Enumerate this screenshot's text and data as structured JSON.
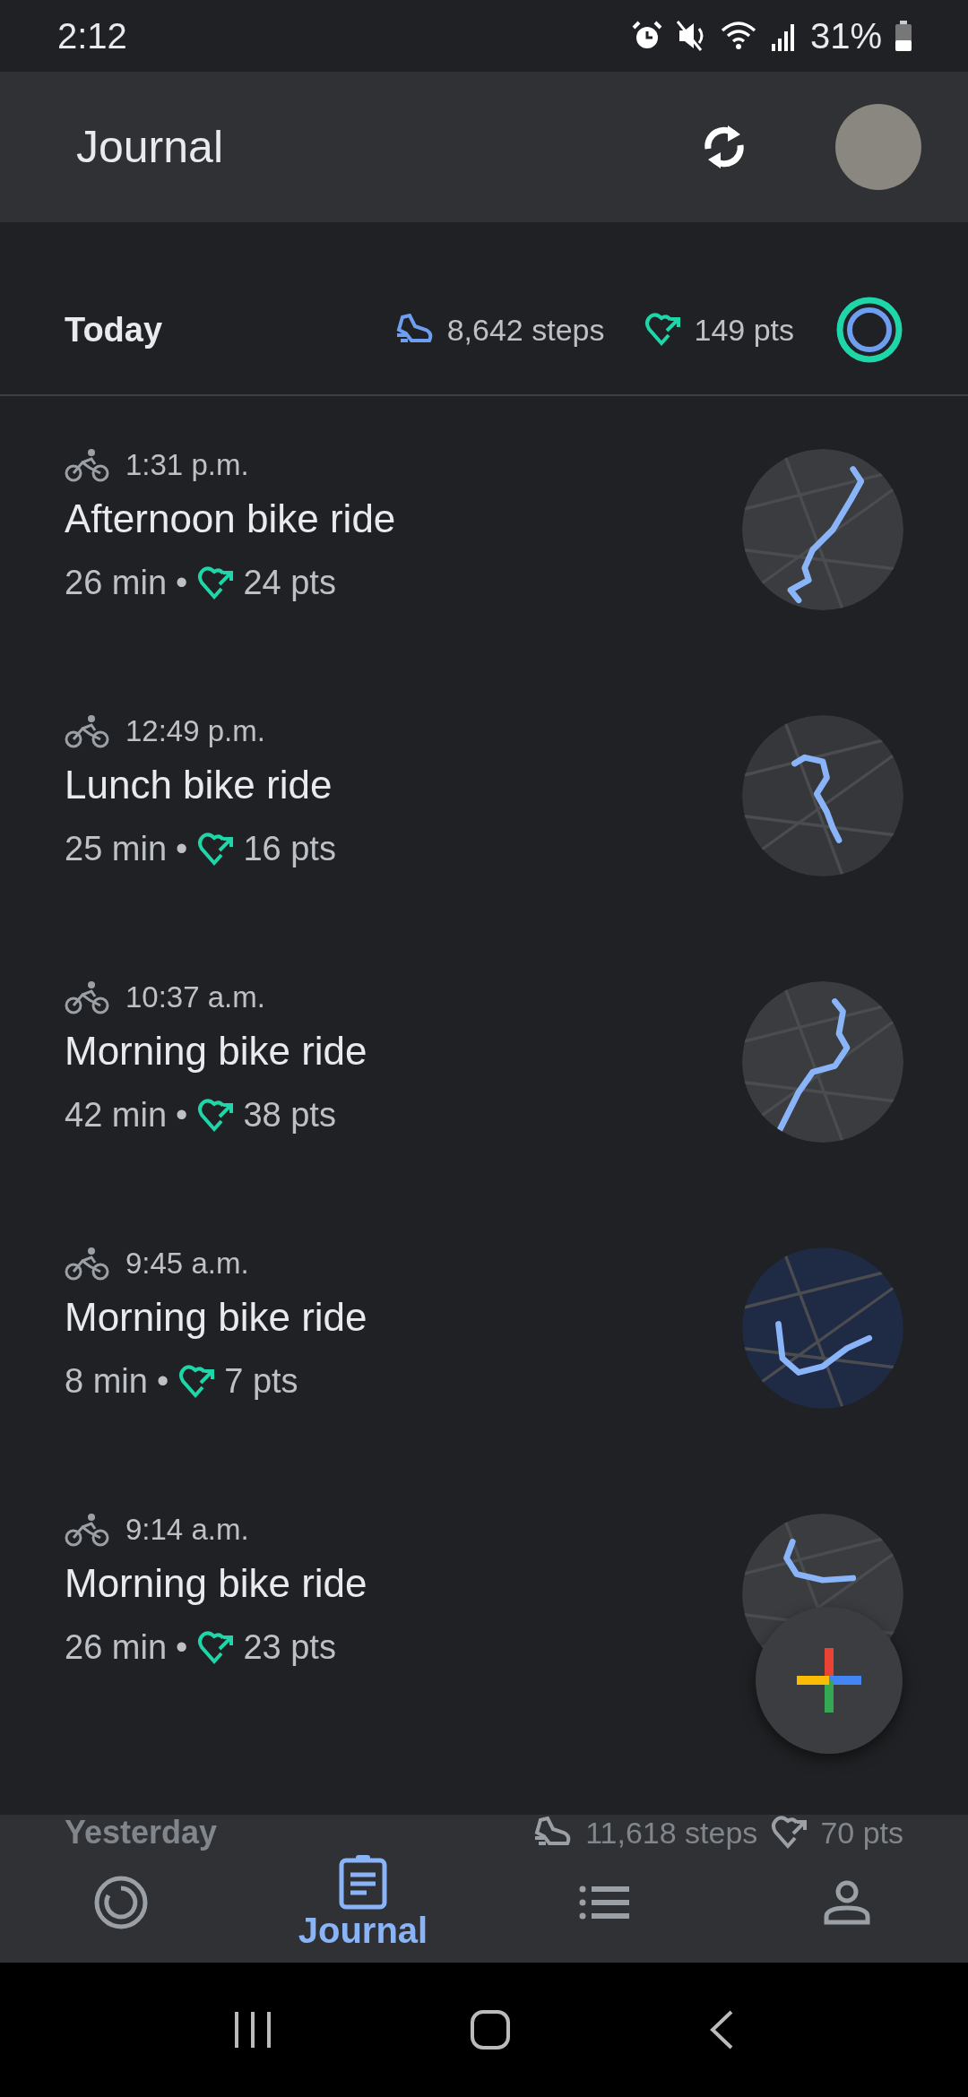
{
  "status_bar": {
    "time": "2:12",
    "battery": "31%"
  },
  "app_bar": {
    "title": "Journal"
  },
  "today": {
    "label": "Today",
    "steps": "8,642 steps",
    "points": "149 pts"
  },
  "activities": [
    {
      "kind": "bike",
      "time": "1:31 p.m.",
      "title": "Afternoon bike ride",
      "duration": "26 min",
      "separator": "•",
      "points": "24 pts"
    },
    {
      "kind": "bike",
      "time": "12:49 p.m.",
      "title": "Lunch bike ride",
      "duration": "25 min",
      "separator": "•",
      "points": "16 pts"
    },
    {
      "kind": "bike",
      "time": "10:37 a.m.",
      "title": "Morning bike ride",
      "duration": "42 min",
      "separator": "•",
      "points": "38 pts"
    },
    {
      "kind": "bike",
      "time": "9:45 a.m.",
      "title": "Morning bike ride",
      "duration": "8 min",
      "separator": "•",
      "points": "7 pts"
    },
    {
      "kind": "bike",
      "time": "9:14 a.m.",
      "title": "Morning bike ride",
      "duration": "26 min",
      "separator": "•",
      "points": "23 pts"
    }
  ],
  "yesterday": {
    "label": "Yesterday",
    "steps": "11,618 steps",
    "points": "70 pts"
  },
  "bottom_nav": [
    {
      "kind": "home",
      "selected": false
    },
    {
      "kind": "journal",
      "label": "Journal",
      "selected": true
    },
    {
      "kind": "browse",
      "selected": false
    },
    {
      "kind": "profile",
      "selected": false
    }
  ]
}
